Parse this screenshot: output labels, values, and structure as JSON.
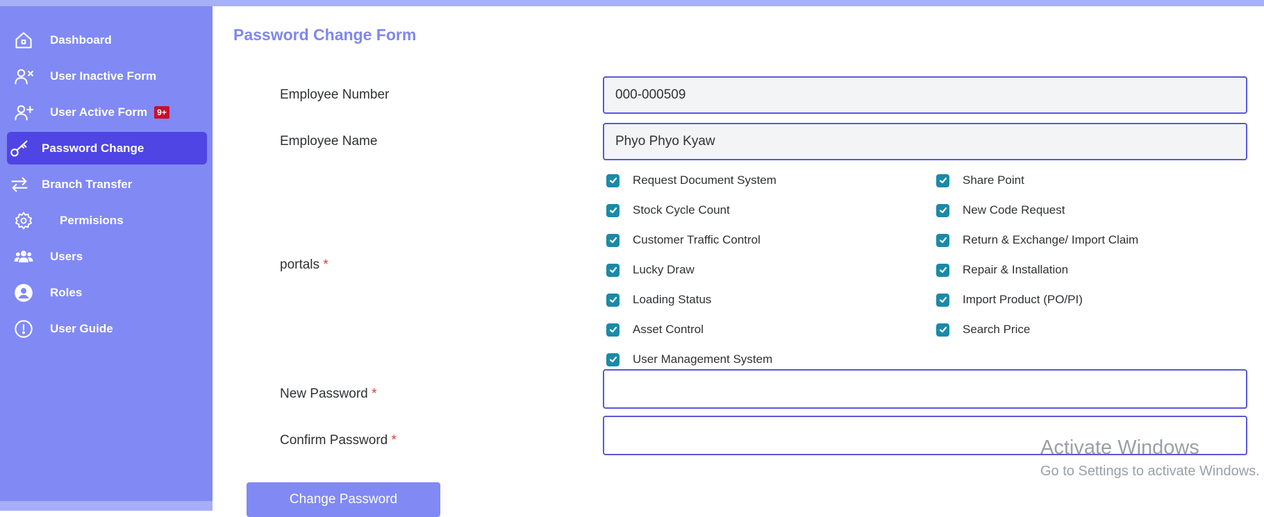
{
  "sidebar": {
    "items": [
      {
        "label": "Dashboard",
        "icon": "home-icon"
      },
      {
        "label": "User Inactive Form",
        "icon": "user-x-icon"
      },
      {
        "label": "User Active Form",
        "icon": "user-plus-icon",
        "badge": "9+"
      },
      {
        "label": "Password Change",
        "icon": "key-icon",
        "active": true
      },
      {
        "label": "Branch Transfer",
        "icon": "transfer-arrows-icon"
      },
      {
        "label": "Permisions",
        "icon": "gear-icon"
      },
      {
        "label": "Users",
        "icon": "users-icon"
      },
      {
        "label": "Roles",
        "icon": "user-circle-icon"
      },
      {
        "label": "User Guide",
        "icon": "info-circle-icon"
      }
    ]
  },
  "form": {
    "title": "Password Change Form",
    "employee_number_label": "Employee Number",
    "employee_number_value": "000-000509",
    "employee_name_label": "Employee Name",
    "employee_name_value": "Phyo Phyo Kyaw",
    "portals_label": "portals",
    "required_mark": "*",
    "portals_left": [
      "Request Document System",
      "Stock Cycle Count",
      "Customer Traffic Control",
      "Lucky Draw",
      "Loading Status",
      "Asset Control",
      "User Management System"
    ],
    "portals_right": [
      "Share Point",
      "New Code Request",
      "Return & Exchange/ Import Claim",
      "Repair & Installation",
      "Import Product (PO/PI)",
      "Search Price"
    ],
    "new_password_label": "New Password",
    "confirm_password_label": "Confirm Password",
    "submit_label": "Change Password"
  },
  "watermark": {
    "line1": "Activate Windows",
    "line2": "Go to Settings to activate Windows."
  },
  "colors": {
    "sidebar_bg": "#8189f4",
    "active_bg": "#4f45e4",
    "checkbox": "#1a8aa8",
    "input_border": "#5b57d8",
    "title": "#7f87ec"
  }
}
